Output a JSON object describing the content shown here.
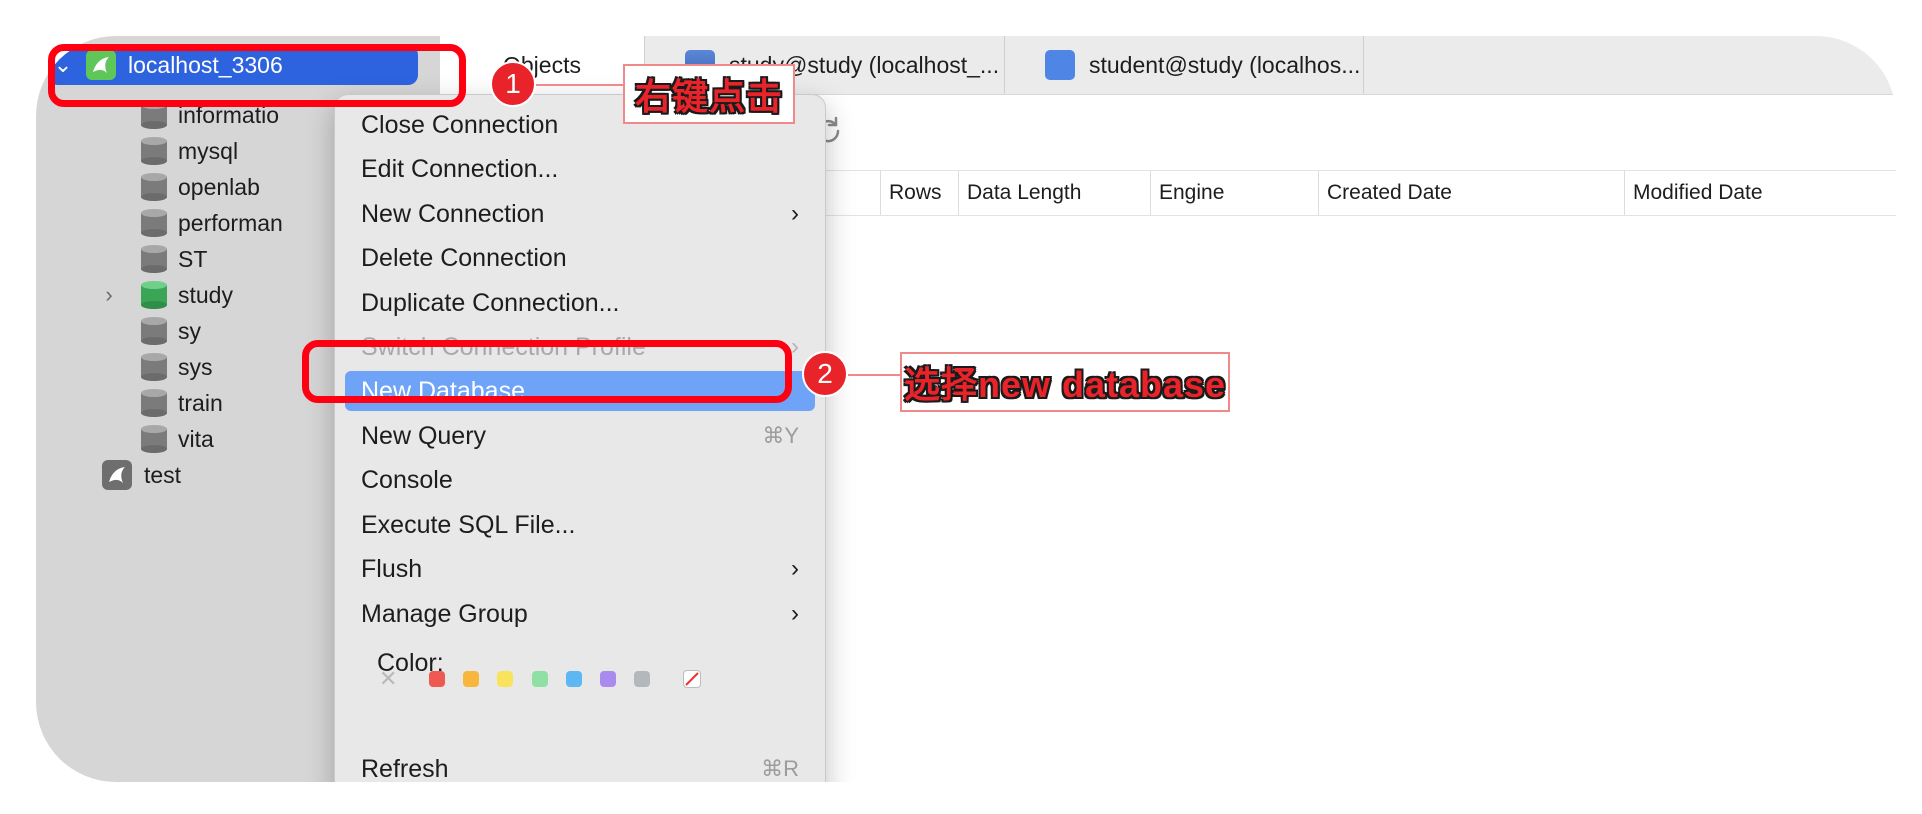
{
  "tabs": [
    {
      "label": "Objects",
      "icon": "none"
    },
    {
      "label": "study@study (localhost_...",
      "icon": "view-icon"
    },
    {
      "label": "student@study (localhos...",
      "icon": "table-icon"
    }
  ],
  "toolbar": {
    "icons": [
      "import-icon",
      "export-icon",
      "refresh-icon"
    ]
  },
  "columns": [
    "Rows",
    "Data Length",
    "Engine",
    "Created Date",
    "Modified Date"
  ],
  "sidebar": {
    "connection": {
      "label": "localhost_3306",
      "expanded": true
    },
    "databases": [
      {
        "label": "information_schema",
        "visible": "informatio"
      },
      {
        "label": "mysql",
        "visible": "mysql"
      },
      {
        "label": "openlab",
        "visible": "openlab"
      },
      {
        "label": "performance_schema",
        "visible": "performan"
      },
      {
        "label": "ST",
        "visible": "ST"
      },
      {
        "label": "study",
        "visible": "study",
        "open": true
      },
      {
        "label": "sy",
        "visible": "sy"
      },
      {
        "label": "sys",
        "visible": "sys"
      },
      {
        "label": "train",
        "visible": "train"
      },
      {
        "label": "vita",
        "visible": "vita"
      }
    ],
    "other_connection": {
      "label": "test"
    }
  },
  "context_menu": {
    "items": [
      {
        "label": "Close Connection",
        "disabled": false
      },
      {
        "label": "Edit Connection...",
        "disabled": false
      },
      {
        "label": "New Connection",
        "submenu": true
      },
      {
        "label": "Delete Connection"
      },
      {
        "label": "Duplicate Connection..."
      },
      {
        "label": "Switch Connection Profile",
        "disabled": true,
        "submenu": true
      },
      {
        "label": "New Database...",
        "highlighted": true
      },
      {
        "label": "New Query",
        "shortcut": "⌘Y"
      },
      {
        "label": "Console"
      },
      {
        "label": "Execute SQL File..."
      },
      {
        "label": "Flush",
        "submenu": true
      },
      {
        "label": "Manage Group",
        "submenu": true
      }
    ],
    "color_label": "Color:",
    "colors": [
      "#ee5a52",
      "#f6b73c",
      "#f8e45c",
      "#8fe0a4",
      "#5db7f3",
      "#a98bf0",
      "#b3b8bd"
    ],
    "refresh": {
      "label": "Refresh",
      "shortcut": "⌘R"
    }
  },
  "annotations": [
    {
      "number": "1",
      "text": "右键点击"
    },
    {
      "number": "2",
      "text": "选择new database"
    }
  ]
}
